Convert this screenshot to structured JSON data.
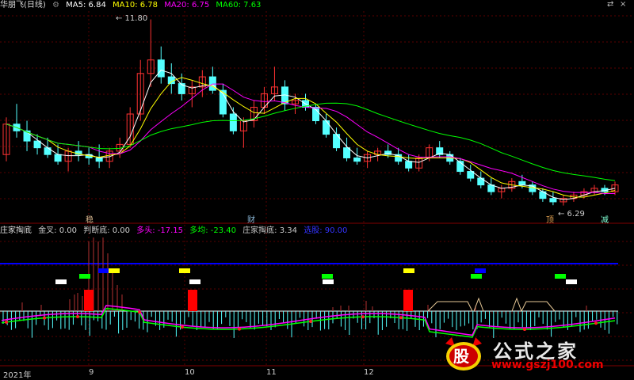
{
  "header": {
    "stock_name": "华朋飞(日线)",
    "ma": [
      {
        "label": "MA5: 6.84",
        "color": "#ffffff"
      },
      {
        "label": "MA10: 6.78",
        "color": "#ffff00"
      },
      {
        "label": "MA20: 6.75",
        "color": "#ff00ff"
      },
      {
        "label": "MA60: 7.63",
        "color": "#00ff00"
      }
    ]
  },
  "indicator_header": {
    "title": "庄家掏底",
    "items": [
      {
        "label": "金叉: 0.00",
        "color": "#cccccc"
      },
      {
        "label": "判断底: 0.00",
        "color": "#cccccc"
      },
      {
        "label": "多头: -17.15",
        "color": "#ff00ff"
      },
      {
        "label": "多均: -23.40",
        "color": "#00ff00"
      },
      {
        "label": "庄家掏底: 3.34",
        "color": "#cccccc"
      },
      {
        "label": "选股: 90.00",
        "color": "#0000ff"
      }
    ]
  },
  "controls": {
    "close": "×",
    "restore": "⇄"
  },
  "annotations": {
    "high": "11.80",
    "low": "6.29"
  },
  "markers": [
    {
      "text": "稳",
      "color": "#d2b48c"
    },
    {
      "text": "财",
      "color": "#8ab6d6"
    },
    {
      "text": "顶",
      "color": "#e0a050"
    },
    {
      "text": "减",
      "color": "#7fffd4"
    }
  ],
  "dates": [
    "2021年",
    "9",
    "10",
    "11",
    "12"
  ],
  "watermark": {
    "logo": "股",
    "title": "公式之家",
    "url": "www.gszj100.com"
  },
  "chart_data": {
    "type": "candlestick",
    "price_range": [
      6.0,
      12.0
    ],
    "ohlc": [
      [
        7.8,
        8.9,
        7.6,
        8.7
      ],
      [
        8.7,
        9.3,
        8.3,
        8.5
      ],
      [
        8.5,
        8.8,
        7.9,
        8.2
      ],
      [
        8.2,
        8.4,
        7.8,
        8.0
      ],
      [
        8.0,
        8.3,
        7.7,
        7.8
      ],
      [
        7.8,
        8.1,
        7.5,
        7.6
      ],
      [
        7.6,
        8.0,
        7.3,
        7.9
      ],
      [
        7.9,
        8.2,
        7.6,
        7.8
      ],
      [
        7.8,
        8.0,
        7.5,
        7.7
      ],
      [
        7.7,
        8.1,
        7.4,
        7.6
      ],
      [
        7.6,
        8.0,
        7.4,
        7.9
      ],
      [
        7.9,
        8.3,
        7.7,
        8.1
      ],
      [
        8.1,
        9.2,
        8.0,
        9.0
      ],
      [
        9.0,
        10.6,
        8.8,
        10.2
      ],
      [
        10.2,
        11.8,
        9.8,
        10.6
      ],
      [
        10.6,
        11.0,
        9.9,
        10.1
      ],
      [
        10.1,
        10.5,
        9.6,
        9.9
      ],
      [
        9.9,
        10.2,
        9.4,
        9.6
      ],
      [
        9.6,
        10.0,
        9.2,
        9.8
      ],
      [
        9.8,
        10.3,
        9.5,
        10.1
      ],
      [
        10.1,
        10.4,
        9.6,
        9.7
      ],
      [
        9.7,
        9.9,
        8.9,
        9.0
      ],
      [
        9.0,
        9.2,
        8.4,
        8.5
      ],
      [
        8.5,
        8.9,
        8.0,
        8.8
      ],
      [
        8.8,
        9.4,
        8.6,
        9.2
      ],
      [
        9.2,
        9.8,
        9.0,
        9.6
      ],
      [
        9.6,
        10.4,
        9.4,
        9.8
      ],
      [
        9.8,
        10.0,
        9.1,
        9.3
      ],
      [
        9.3,
        9.6,
        9.0,
        9.4
      ],
      [
        9.4,
        9.6,
        9.1,
        9.2
      ],
      [
        9.2,
        9.3,
        8.7,
        8.8
      ],
      [
        8.8,
        9.0,
        8.3,
        8.4
      ],
      [
        8.4,
        8.6,
        7.9,
        8.0
      ],
      [
        8.0,
        8.3,
        7.6,
        7.7
      ],
      [
        7.7,
        8.0,
        7.5,
        7.6
      ],
      [
        7.6,
        7.9,
        7.4,
        7.8
      ],
      [
        7.8,
        8.0,
        7.6,
        7.9
      ],
      [
        7.9,
        8.1,
        7.7,
        7.8
      ],
      [
        7.8,
        8.0,
        7.5,
        7.6
      ],
      [
        7.6,
        7.8,
        7.3,
        7.4
      ],
      [
        7.4,
        7.8,
        7.3,
        7.7
      ],
      [
        7.7,
        8.1,
        7.6,
        8.0
      ],
      [
        8.0,
        8.2,
        7.7,
        7.8
      ],
      [
        7.8,
        7.9,
        7.5,
        7.6
      ],
      [
        7.6,
        7.7,
        7.2,
        7.3
      ],
      [
        7.3,
        7.5,
        7.0,
        7.1
      ],
      [
        7.1,
        7.3,
        6.8,
        6.9
      ],
      [
        6.9,
        7.1,
        6.6,
        6.7
      ],
      [
        6.7,
        6.9,
        6.5,
        6.8
      ],
      [
        6.8,
        7.1,
        6.7,
        7.0
      ],
      [
        7.0,
        7.2,
        6.8,
        6.9
      ],
      [
        6.9,
        7.0,
        6.6,
        6.7
      ],
      [
        6.7,
        6.8,
        6.4,
        6.5
      ],
      [
        6.5,
        6.7,
        6.3,
        6.4
      ],
      [
        6.4,
        6.6,
        6.29,
        6.5
      ],
      [
        6.5,
        6.7,
        6.4,
        6.6
      ],
      [
        6.6,
        6.8,
        6.5,
        6.7
      ],
      [
        6.7,
        6.9,
        6.6,
        6.8
      ],
      [
        6.8,
        6.9,
        6.6,
        6.7
      ],
      [
        6.7,
        7.0,
        6.6,
        6.9
      ]
    ]
  }
}
